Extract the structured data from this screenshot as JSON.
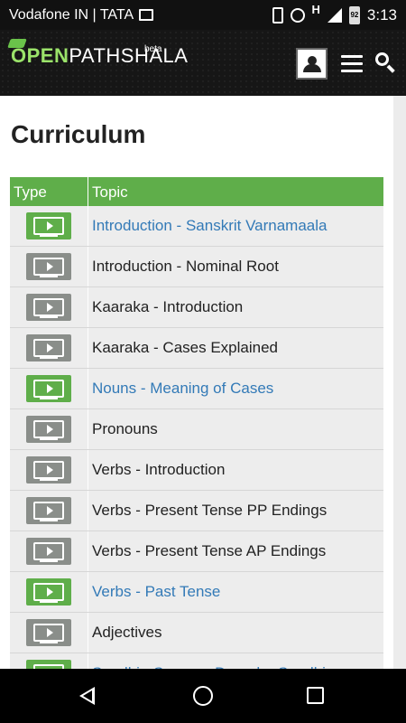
{
  "status_bar": {
    "carrier": "Vodafone IN | TATA",
    "network": "H",
    "battery": "92",
    "time": "3:13"
  },
  "app": {
    "logo_open": "OPEN",
    "logo_rest": "PATHSHALA",
    "logo_beta": "beta"
  },
  "page": {
    "heading": "Curriculum"
  },
  "table": {
    "headers": [
      "Type",
      "Topic"
    ],
    "rows": [
      {
        "topic": "Introduction - Sanskrit Varnamaala",
        "state": "active"
      },
      {
        "topic": "Introduction - Nominal Root",
        "state": "locked"
      },
      {
        "topic": "Kaaraka - Introduction",
        "state": "locked"
      },
      {
        "topic": "Kaaraka - Cases Explained",
        "state": "locked"
      },
      {
        "topic": "Nouns - Meaning of Cases",
        "state": "active"
      },
      {
        "topic": "Pronouns",
        "state": "locked"
      },
      {
        "topic": "Verbs - Introduction",
        "state": "locked"
      },
      {
        "topic": "Verbs - Present Tense PP Endings",
        "state": "locked"
      },
      {
        "topic": "Verbs - Present Tense AP Endings",
        "state": "locked"
      },
      {
        "topic": "Verbs - Past Tense",
        "state": "active"
      },
      {
        "topic": "Adjectives",
        "state": "locked"
      },
      {
        "topic": "Sandhi - Savarna Deergha Sandhi",
        "state": "active"
      }
    ]
  },
  "colors": {
    "accent_green": "#5fae4a",
    "link_blue": "#337ab7",
    "locked_gray": "#8a8e8a"
  },
  "icons": {
    "row_type": "video-play-icon",
    "profile": "user-profile-icon",
    "menu": "hamburger-menu-icon",
    "search": "search-icon"
  }
}
